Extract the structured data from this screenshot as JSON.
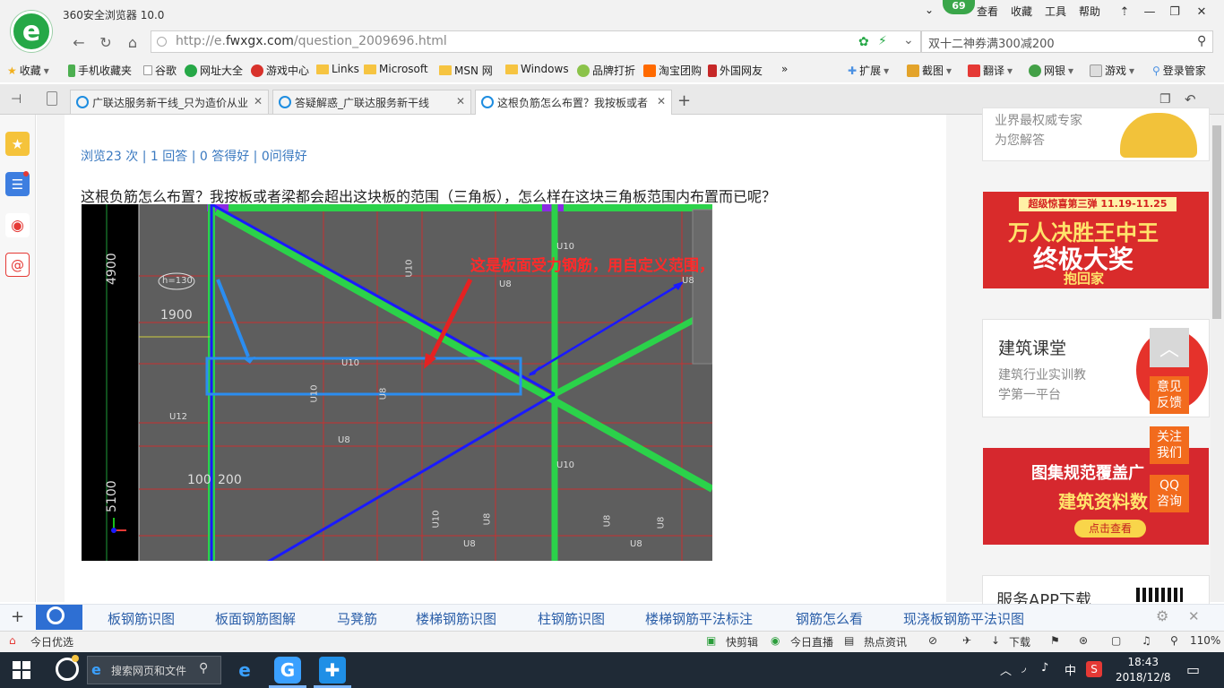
{
  "browser": {
    "title": "360安全浏览器 10.0",
    "badge_count": "69",
    "menu": [
      "查看",
      "收藏",
      "工具",
      "帮助"
    ],
    "url_prefix": "http://e.",
    "url_domain": "fwxgx.com",
    "url_path": "/question_2009696.html",
    "search_value": "双十二神券满300减200",
    "icons": {
      "logo": "360-browser-logo-icon",
      "back": "back-arrow-icon",
      "refresh": "refresh-icon",
      "home": "home-icon",
      "search": "search-icon"
    }
  },
  "bookmarks": {
    "left": [
      "收藏",
      "手机收藏夹",
      "谷歌",
      "网址大全",
      "游戏中心",
      "Links",
      "Microsoft",
      "MSN 网",
      "Windows",
      "品牌打折",
      "淘宝团购",
      "外国网友"
    ],
    "more": "»",
    "right": [
      "扩展",
      "截图",
      "翻译",
      "网银",
      "游戏",
      "登录管家"
    ]
  },
  "tabs": [
    {
      "label": "广联达服务新干线_只为造价从业",
      "active": false
    },
    {
      "label": "答疑解惑_广联达服务新干线",
      "active": false
    },
    {
      "label": "这根负筋怎么布置？我按板或者",
      "active": true
    }
  ],
  "article": {
    "stats": "浏览23 次 | 1 回答 | 0 答得好 | 0问得好",
    "question": "这根负筋怎么布置？我按板或者梁都会超出这块板的范围（三角板），怎么样在这块三角板范围内布置而已呢？"
  },
  "cad": {
    "annotation": "这是板面受力钢筋，用自定义范围，水平布置",
    "dims": [
      "4900",
      "1900",
      "100",
      "200",
      "5100"
    ],
    "label_h": "h=130",
    "rebar_labels": [
      "U10",
      "U8",
      "U10",
      "U10",
      "U8",
      "U12",
      "U8",
      "U10",
      "U10",
      "U8",
      "U10",
      "U8",
      "U8",
      "U8",
      "U8",
      "U8"
    ]
  },
  "right": {
    "panel1_lines": [
      "业界最权威专家",
      "为您解答"
    ],
    "ad1_top": "超级惊喜第三弹  11.19-11.25",
    "ad1_main": "万人决胜王中王",
    "ad1_big": "终极大奖",
    "ad1_sub": "抱回家",
    "panel2_title": "建筑课堂",
    "panel2_lines": [
      "建筑行业实训教",
      "学第一平台"
    ],
    "ad2_line1": "图集规范覆盖广",
    "ad2_line2": "建筑资料数",
    "ad2_link": "点击查看",
    "panel3_title": "服务APP下载",
    "feedback": [
      "意见反馈",
      "关注我们",
      "QQ咨询"
    ]
  },
  "related": {
    "links": [
      "板钢筋识图",
      "板面钢筋图解",
      "马凳筋",
      "楼梯钢筋识图",
      "柱钢筋识图",
      "楼梯钢筋平法标注",
      "钢筋怎么看",
      "现浇板钢筋平法识图"
    ]
  },
  "status": {
    "left": "今日优选",
    "items": [
      "快剪辑",
      "今日直播",
      "热点资讯",
      "下载"
    ],
    "zoom": "110%"
  },
  "taskbar": {
    "search_placeholder": "搜索网页和文件",
    "ime": "中",
    "time": "18:43",
    "date": "2018/12/8"
  },
  "colors": {
    "accent_blue": "#2a5ea8",
    "green": "#26a847",
    "orange": "#f26b1d",
    "cad_green": "#2bd24a",
    "cad_bg": "#5e5e5e"
  }
}
